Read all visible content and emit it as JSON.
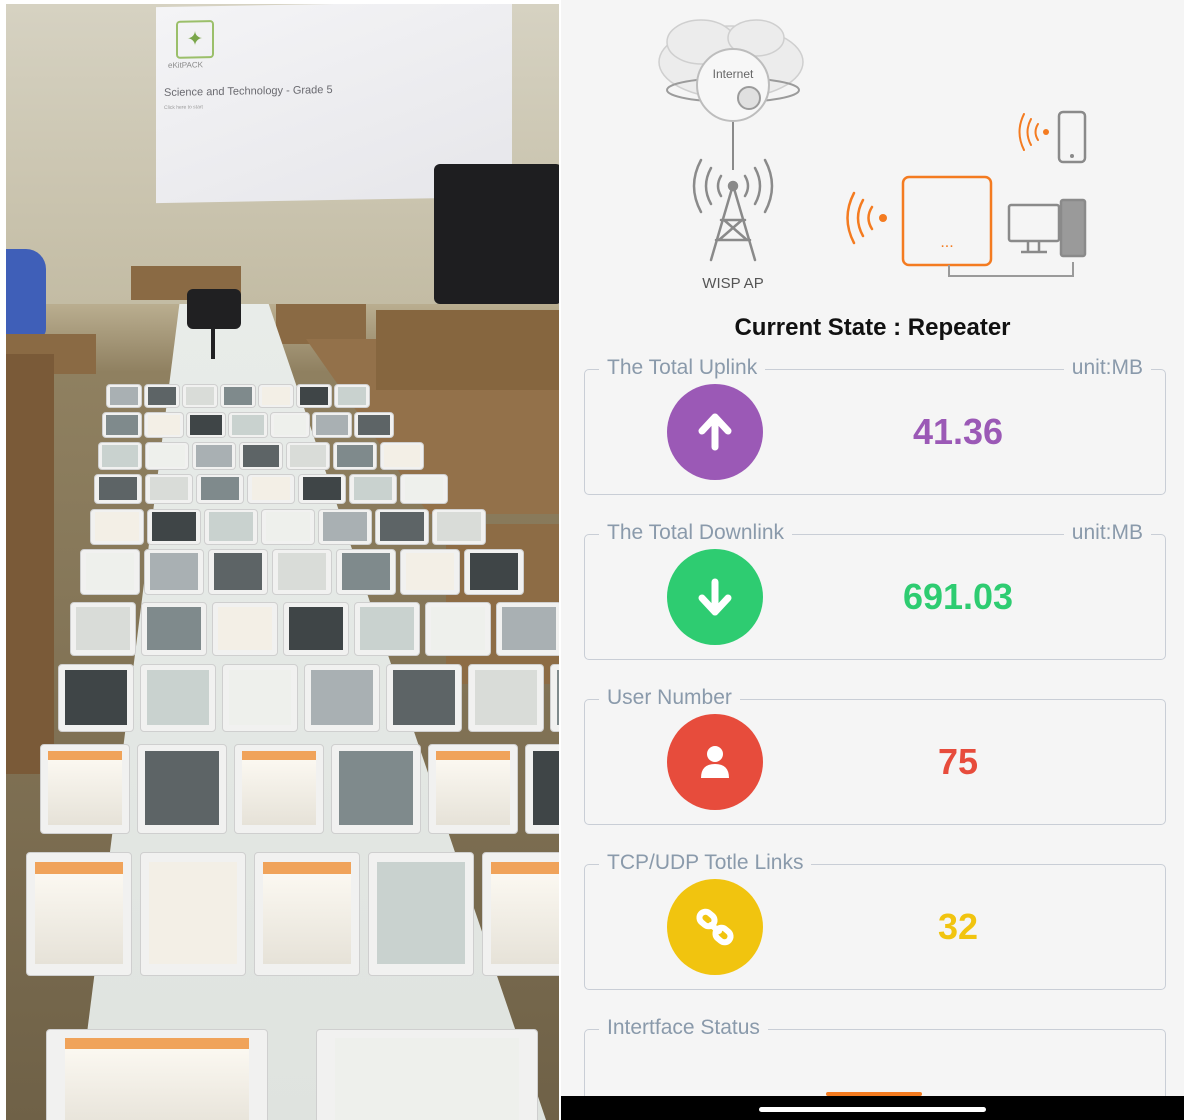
{
  "photo": {
    "screen_brand": "eKitPACK",
    "screen_title": "Science and Technology - Grade 5",
    "screen_sub": "Click here to start"
  },
  "diagram": {
    "cloud_label": "Internet",
    "ap_label": "WISP AP",
    "router_label": "...",
    "accent_color": "#f47b20",
    "line_color": "#8a8a8a"
  },
  "status": {
    "current_state": "Current State : Repeater"
  },
  "uplink": {
    "legend": "The Total Uplink",
    "unit": "unit:MB",
    "value": "41.36",
    "icon": "arrow-up-icon",
    "color": "#9b59b6"
  },
  "downlink": {
    "legend": "The Total Downlink",
    "unit": "unit:MB",
    "value": "691.03",
    "icon": "arrow-down-icon",
    "color": "#2ecc71"
  },
  "users": {
    "legend": "User Number",
    "value": "75",
    "icon": "user-icon",
    "color": "#e74c3c"
  },
  "links": {
    "legend": "TCP/UDP Totle Links",
    "value": "32",
    "icon": "link-icon",
    "color": "#f1c40f"
  },
  "interface": {
    "legend": "Intertface Status"
  }
}
